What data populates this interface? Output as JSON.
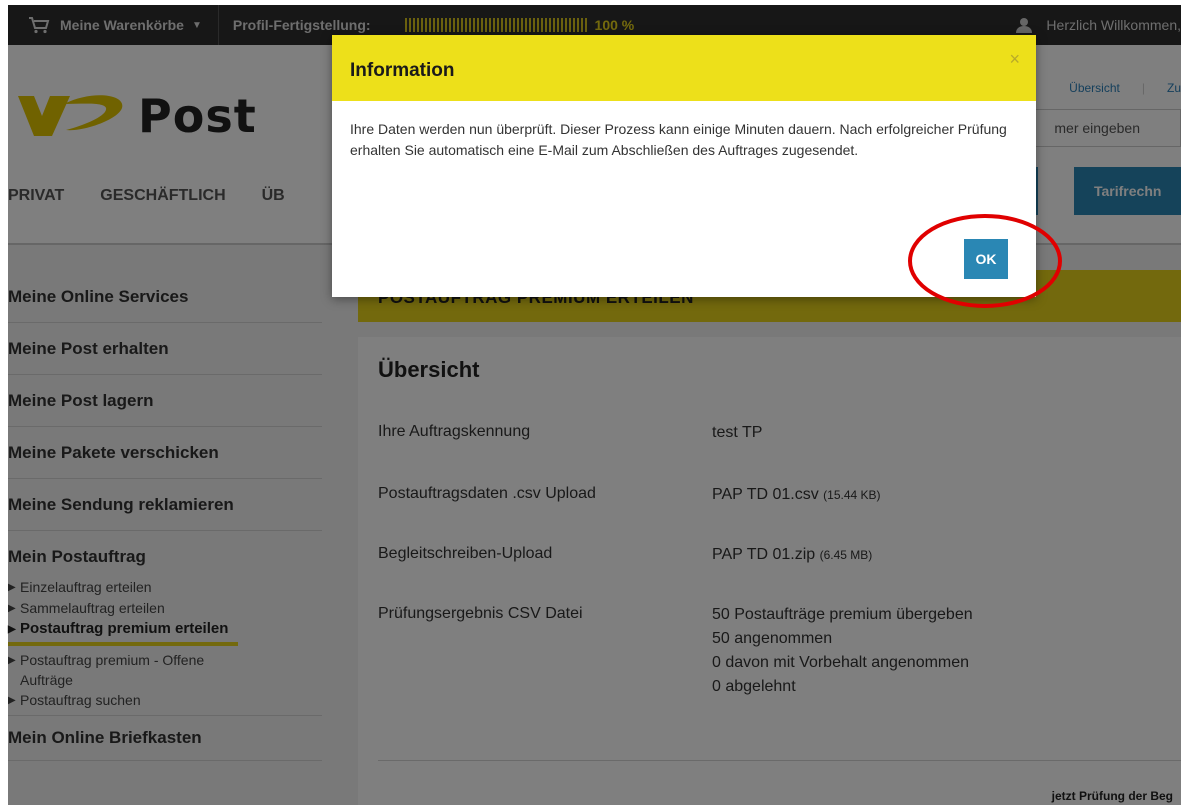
{
  "topbar": {
    "cart_label": "Meine Warenkörbe",
    "profile_label": "Profil-Fertigstellung:",
    "profile_progress": 1.0,
    "profile_percent": "100 %",
    "welcome": "Herzlich Willkommen,"
  },
  "header": {
    "logo_text": "Post",
    "nav": [
      "PRIVAT",
      "GESCHÄFTLICH",
      "ÜB"
    ],
    "toplinks": [
      "Übersicht",
      "Zu"
    ],
    "search_placeholder": "mer eingeben",
    "button_tarif": "Tarifrechn"
  },
  "sidebar": {
    "items": [
      "Meine Online Services",
      "Meine Post erhalten",
      "Meine Post lagern",
      "Meine Pakete verschicken",
      "Meine Sendung reklamieren"
    ],
    "section": "Mein Postauftrag",
    "sub_items": [
      "Einzelauftrag erteilen",
      "Sammelauftrag erteilen",
      "Postauftrag premium erteilen",
      "Postauftrag premium - Offene Aufträge",
      "Postauftrag suchen"
    ],
    "last_item": "Mein Online Briefkasten"
  },
  "main": {
    "band_title": "POSTAUFTRAG PREMIUM ERTEILEN",
    "heading": "Übersicht",
    "fields": {
      "kennung_label": "Ihre Auftragskennung",
      "kennung_value": "test TP",
      "csv_label": "Postauftragsdaten .csv Upload",
      "csv_value": "PAP TD 01.csv",
      "csv_size": "(15.44 KB)",
      "begleit_label": "Begleitschreiben-Upload",
      "begleit_value": "PAP TD 01.zip",
      "begleit_size": "(6.45 MB)",
      "pruef_label": "Prüfungsergebnis CSV Datei",
      "pruef_lines": [
        "50 Postaufträge premium übergeben",
        "50 angenommen",
        "0 davon mit Vorbehalt angenommen",
        "0 abgelehnt"
      ]
    },
    "footer_text": "jetzt Prüfung der Beg"
  },
  "modal": {
    "title": "Information",
    "close": "×",
    "body": "Ihre Daten werden nun überprüft. Dieser Prozess kann einige Minuten dauern. Nach erfolgreicher Prüfung erhalten Sie automatisch eine E-Mail zum Abschließen des Auftrages zugesendet.",
    "ok_label": "OK"
  },
  "colors": {
    "post_yellow": "#e6d21a",
    "modal_yellow": "#ede01a",
    "button_blue": "#2a87b4",
    "highlight_red": "#e00000"
  }
}
